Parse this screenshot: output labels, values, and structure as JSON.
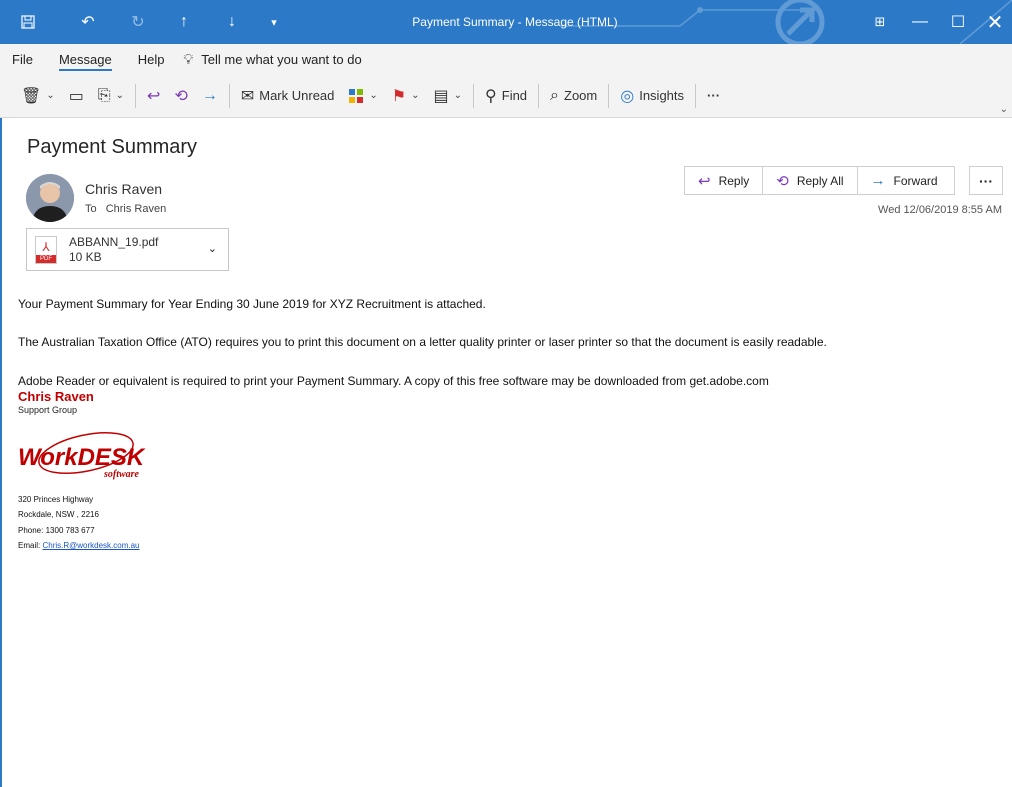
{
  "window": {
    "title": "Payment Summary  -  Message (HTML)"
  },
  "menu": {
    "items": [
      "File",
      "Message",
      "Help"
    ],
    "active": "Message",
    "tell_me": "Tell me what you want to do"
  },
  "ribbon": {
    "mark_unread": "Mark Unread",
    "find": "Find",
    "zoom": "Zoom",
    "insights": "Insights",
    "more": "···"
  },
  "message": {
    "subject": "Payment Summary",
    "sender": "Chris Raven",
    "to_label": "To",
    "to_name": "Chris Raven",
    "date": "Wed 12/06/2019 8:55 AM",
    "actions": {
      "reply": "Reply",
      "reply_all": "Reply All",
      "forward": "Forward",
      "more": "···"
    },
    "attachment": {
      "name": "ABBANN_19.pdf",
      "size": "10 KB",
      "type_label": "PDF"
    }
  },
  "body": {
    "line1": "Your Payment Summary for Year Ending 30 June 2019 for XYZ Recruitment is attached.",
    "line2": "The Australian Taxation Office (ATO) requires you to print this document on a letter quality printer or laser printer so that the document is easily readable.",
    "line3": "Adobe Reader or equivalent is required to print your Payment Summary. A copy of this free software may be downloaded from get.adobe.com"
  },
  "signature": {
    "name": "Chris Raven",
    "group": "Support Group",
    "logo_text": "WorkDESK",
    "logo_sub": "software",
    "address1": "320 Princes Highway",
    "address2": "Rockdale, NSW , 2216",
    "phone_label": "Phone:",
    "phone": "1300 783 677",
    "email_label": "Email:",
    "email": "Chris.R@workdesk.com.au"
  },
  "colors": {
    "titlebar": "#2b79c7",
    "signature_name": "#c00000",
    "link": "#1a55c7"
  }
}
